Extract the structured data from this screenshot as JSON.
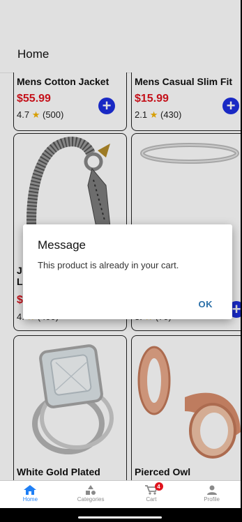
{
  "header": {
    "title": "Home"
  },
  "products": [
    {
      "name": "Mens Cotton Jacket",
      "price": "$55.99",
      "rating": "4.7",
      "count": "(500)"
    },
    {
      "name": "Mens Casual Slim Fit",
      "price": "$15.99",
      "rating": "2.1",
      "count": "(430)"
    },
    {
      "name": "J",
      "name2": "L",
      "price": "$",
      "rating": "4.",
      "count": "(400)"
    },
    {
      "name": "",
      "price": "",
      "rating": "3.",
      "count": "(70)"
    },
    {
      "name": "White Gold Plated"
    },
    {
      "name": "Pierced Owl"
    }
  ],
  "dialog": {
    "title": "Message",
    "message": "This product is already in your cart.",
    "ok": "OK"
  },
  "tabs": [
    {
      "label": "Home",
      "icon": "home-icon"
    },
    {
      "label": "Categories",
      "icon": "categories-icon"
    },
    {
      "label": "Cart",
      "icon": "cart-icon",
      "badge": "4"
    },
    {
      "label": "Profile",
      "icon": "profile-icon"
    }
  ],
  "colors": {
    "price": "#e0141e",
    "add_button": "#1d2fe0",
    "active_tab": "#1f7ff5",
    "ok": "#2a6fa8"
  }
}
